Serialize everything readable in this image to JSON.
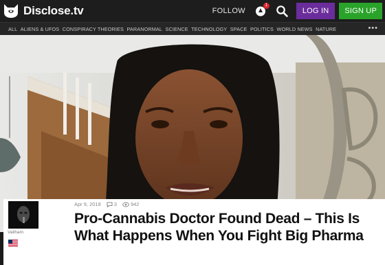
{
  "brand": {
    "name": "Disclose.tv"
  },
  "header": {
    "follow_label": "FOLLOW",
    "notification_count": "1",
    "login_label": "LOG IN",
    "signup_label": "SIGN UP"
  },
  "nav": {
    "items": [
      "ALL",
      "ALIENS & UFOS",
      "CONSPIRACY THEORIES",
      "PARANORMAL",
      "SCIENCE",
      "TECHNOLOGY",
      "SPACE",
      "POLITICS",
      "WORLD NEWS",
      "NATURE"
    ],
    "more_label": "•••"
  },
  "article": {
    "author": "Valiham",
    "date": "Apr 9, 2018",
    "comments": "3",
    "views": "942",
    "title": "Pro-Cannabis Doctor Found Dead – This Is What Happens When You Fight Big Pharma"
  },
  "colors": {
    "login_bg": "#6b2d9c",
    "signup_bg": "#2aa32a",
    "topbar_bg": "#1d1d1d",
    "badge": "#d9262b"
  },
  "icons": {
    "logo": "cat-head-logo-icon",
    "bell": "notification-bell-icon",
    "search": "search-icon",
    "comments": "comment-bubble-icon",
    "views": "eye-icon",
    "flag": "us-flag-icon"
  }
}
